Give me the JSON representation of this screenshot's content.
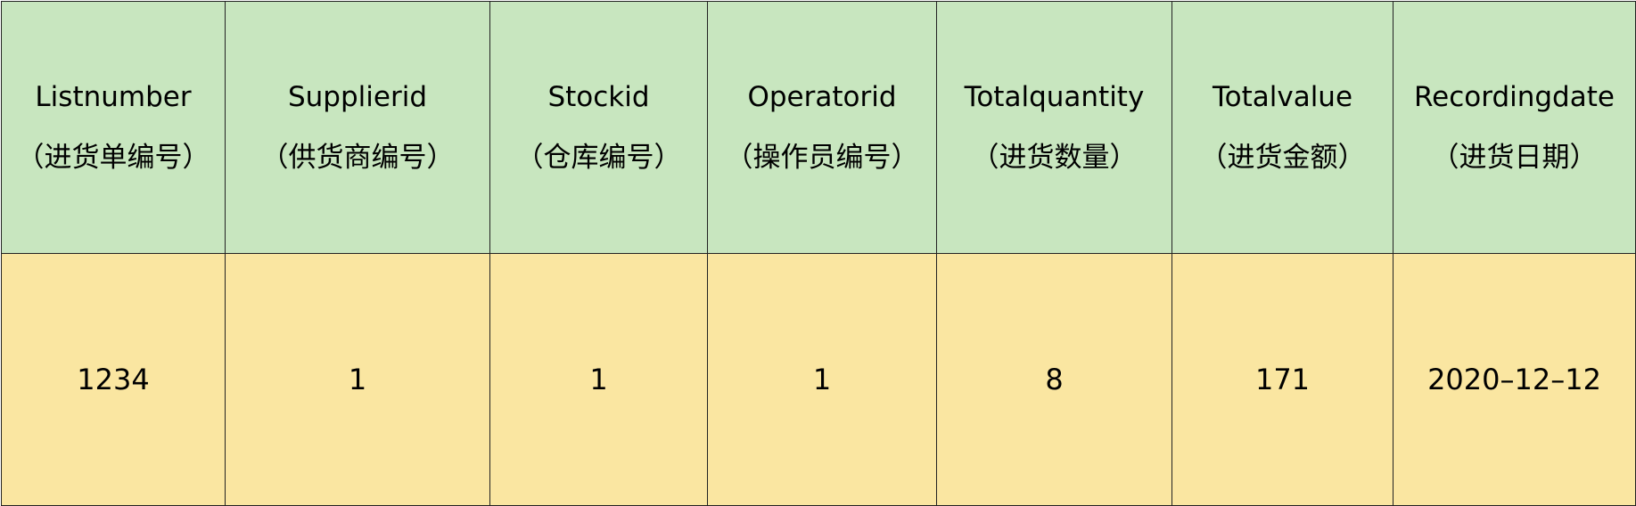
{
  "colors": {
    "header_bg": "#c8e6bf",
    "body_bg": "#fae6a1",
    "border": "#222222"
  },
  "table": {
    "headers": [
      {
        "en": "Listnumber",
        "zh": "（进货单编号）"
      },
      {
        "en": "Supplierid",
        "zh": "（供货商编号）"
      },
      {
        "en": "Stockid",
        "zh": "（仓库编号）"
      },
      {
        "en": "Operatorid",
        "zh": "（操作员编号）"
      },
      {
        "en": "Totalquantity",
        "zh": "（进货数量）"
      },
      {
        "en": "Totalvalue",
        "zh": "（进货金额）"
      },
      {
        "en": "Recordingdate",
        "zh": "（进货日期）"
      }
    ],
    "rows": [
      [
        "1234",
        "1",
        "1",
        "1",
        "8",
        "171",
        "2020–12–12"
      ]
    ]
  }
}
